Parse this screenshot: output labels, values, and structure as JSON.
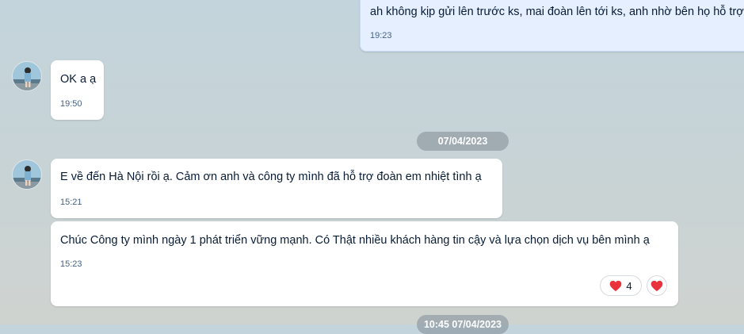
{
  "messages": [
    {
      "text": "ah không kịp gửi lên trước ks, mai đoàn lên tới ks, anh nhờ bên họ hỗ trợ",
      "time": "19:23"
    },
    {
      "text": "OK a ạ",
      "time": "19:50"
    },
    {
      "text": "E về đến Hà Nội rồi ạ. Cảm ơn anh và công ty mình đã hỗ trợ đoàn em nhiệt tình ạ",
      "time": "15:21"
    },
    {
      "text": "Chúc Công ty mình ngày 1 phát triển vững mạnh. Có Thật nhiều khách hàng tin cậy và lựa chọn dịch vụ bên mình ạ",
      "time": "15:23"
    }
  ],
  "date_separators": [
    "07/04/2023",
    "10:45 07/04/2023"
  ],
  "reaction": {
    "icon": "heart-icon",
    "count": "4",
    "color": "#e8323c"
  },
  "react_button_icon": "heart-icon"
}
